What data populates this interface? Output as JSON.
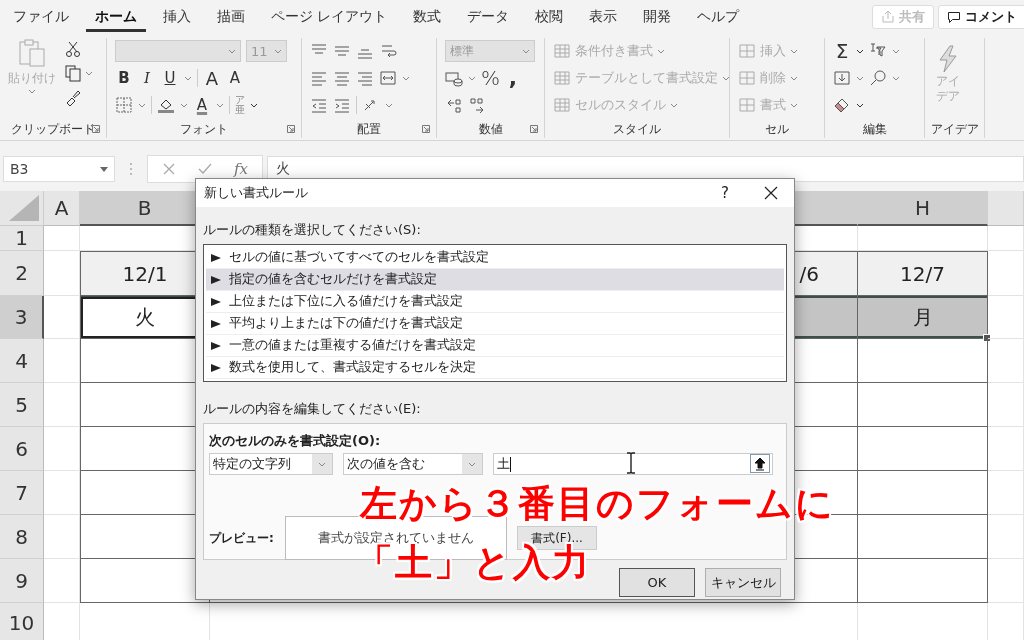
{
  "tabs": [
    {
      "label": "ファイル",
      "selected": false
    },
    {
      "label": "ホーム",
      "selected": true
    },
    {
      "label": "挿入",
      "selected": false
    },
    {
      "label": "描画",
      "selected": false
    },
    {
      "label": "ページ レイアウト",
      "selected": false
    },
    {
      "label": "数式",
      "selected": false
    },
    {
      "label": "データ",
      "selected": false
    },
    {
      "label": "校閲",
      "selected": false
    },
    {
      "label": "表示",
      "selected": false
    },
    {
      "label": "開発",
      "selected": false
    },
    {
      "label": "ヘルプ",
      "selected": false
    }
  ],
  "share_button": {
    "label": "共有",
    "disabled": true
  },
  "comment_button": {
    "label": "コメント"
  },
  "ribbon": {
    "clipboard": {
      "label": "クリップボード",
      "paste": "貼り付け",
      "paste_disabled": true
    },
    "font": {
      "label": "フォント",
      "size": "11",
      "bold": "B",
      "italic": "I",
      "underline": "U",
      "grow": "A",
      "shrink": "A",
      "font_color": "A",
      "phonetic": [
        "ア",
        "亜"
      ]
    },
    "alignment": {
      "label": "配置"
    },
    "number": {
      "label": "数値",
      "format": "標準",
      "format_disabled": true,
      "percent": "%",
      "comma": ","
    },
    "styles": {
      "label": "スタイル",
      "disabled": true,
      "items": [
        "条件付き書式",
        "テーブルとして書式設定",
        "セルのスタイル"
      ]
    },
    "cells": {
      "label": "セル",
      "disabled": true,
      "items": [
        "挿入",
        "削除",
        "書式"
      ]
    },
    "editing": {
      "label": "編集",
      "sum": "Σ"
    },
    "ideas": {
      "label": "アイデア",
      "button": "アイデア",
      "disabled": true
    }
  },
  "formula_bar": {
    "name_box": "B3",
    "fx": "fx",
    "formula": "火"
  },
  "sheet": {
    "columns": [
      {
        "label": "A",
        "selected": false
      },
      {
        "label": "B",
        "selected": true
      },
      {
        "selected": true
      },
      {
        "label": "H",
        "selected": true
      }
    ],
    "rows": [
      {
        "label": "1",
        "selected": false,
        "kind": "blank",
        "cells": [
          {
            "selected": false
          },
          {
            "selected": false
          },
          {
            "selected": false
          },
          {
            "selected": false
          }
        ]
      },
      {
        "label": "2",
        "selected": false,
        "kind": "header",
        "cells": [
          {
            "selected": false
          },
          {
            "text": "12/1",
            "selected": false
          },
          {
            "text": "/6",
            "selected": false
          },
          {
            "text": "12/7",
            "selected": false
          }
        ]
      },
      {
        "label": "3",
        "selected": true,
        "kind": "body",
        "cells": [
          {
            "selected": false
          },
          {
            "text": "火",
            "selected": true,
            "active": true
          },
          {
            "selected": true
          },
          {
            "text": "月",
            "selected": true
          }
        ]
      },
      {
        "label": "4",
        "selected": false,
        "kind": "body",
        "cells": [
          {
            "selected": false
          },
          {
            "selected": false
          },
          {
            "selected": false
          },
          {
            "selected": false
          }
        ]
      },
      {
        "label": "5",
        "selected": false,
        "kind": "body",
        "cells": [
          {
            "selected": false
          },
          {
            "selected": false
          },
          {
            "selected": false
          },
          {
            "selected": false
          }
        ]
      },
      {
        "label": "6",
        "selected": false,
        "kind": "body",
        "cells": [
          {
            "selected": false
          },
          {
            "selected": false
          },
          {
            "selected": false
          },
          {
            "selected": false
          }
        ]
      },
      {
        "label": "7",
        "selected": false,
        "kind": "body",
        "cells": [
          {
            "selected": false
          },
          {
            "selected": false
          },
          {
            "selected": false
          },
          {
            "selected": false
          }
        ]
      },
      {
        "label": "8",
        "selected": false,
        "kind": "body",
        "cells": [
          {
            "selected": false
          },
          {
            "selected": false
          },
          {
            "selected": false
          },
          {
            "selected": false
          }
        ]
      },
      {
        "label": "9",
        "selected": false,
        "kind": "body",
        "cells": [
          {
            "selected": false
          },
          {
            "selected": false
          },
          {
            "selected": false
          },
          {
            "selected": false
          }
        ]
      },
      {
        "label": "10",
        "selected": false,
        "kind": "blank",
        "cells": [
          {
            "selected": false
          },
          {
            "selected": false
          },
          {
            "selected": false
          },
          {
            "selected": false
          }
        ]
      }
    ]
  },
  "dialog": {
    "title": "新しい書式ルール",
    "help": "?",
    "rule_type_label": "ルールの種類を選択してください(S):",
    "rule_types": [
      {
        "label": "セルの値に基づいてすべてのセルを書式設定",
        "selected": false
      },
      {
        "label": "指定の値を含むセルだけを書式設定",
        "selected": true
      },
      {
        "label": "上位または下位に入る値だけを書式設定",
        "selected": false
      },
      {
        "label": "平均より上または下の値だけを書式設定",
        "selected": false
      },
      {
        "label": "一意の値または重複する値だけを書式設定",
        "selected": false
      },
      {
        "label": "数式を使用して、書式設定するセルを決定",
        "selected": false
      }
    ],
    "edit_label": "ルールの内容を編集してください(E):",
    "condition_label": "次のセルのみを書式設定(O):",
    "condition_type": "特定の文字列",
    "operator": "次の値を含む",
    "value": "土",
    "preview_label": "プレビュー:",
    "preview_text": "書式が設定されていません",
    "format_button": "書式(F)...",
    "ok": "OK",
    "cancel": "キャンセル"
  },
  "annotation": {
    "lines": [
      "左から３番目のフォームに",
      "「土」と入力"
    ]
  }
}
